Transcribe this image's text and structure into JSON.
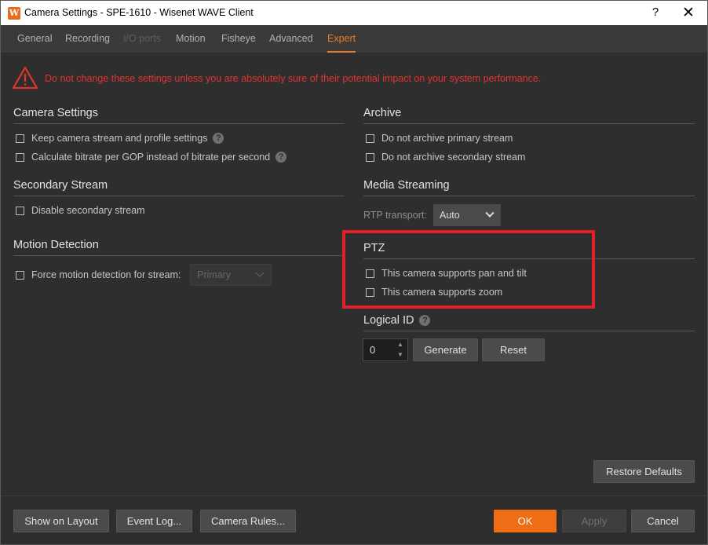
{
  "window": {
    "title": "Camera Settings - SPE-1610 - Wisenet WAVE Client",
    "app_icon": "W",
    "help": "?",
    "close": "✕"
  },
  "tabs": [
    {
      "label": "General",
      "state": "normal"
    },
    {
      "label": "Recording",
      "state": "normal"
    },
    {
      "label": "I/O ports",
      "state": "disabled"
    },
    {
      "label": "Motion",
      "state": "normal"
    },
    {
      "label": "Fisheye",
      "state": "normal"
    },
    {
      "label": "Advanced",
      "state": "normal"
    },
    {
      "label": "Expert",
      "state": "active"
    }
  ],
  "warning": {
    "icon": "warning-triangle-icon",
    "text": "Do not change these settings unless you are absolutely sure of their potential impact on your system performance."
  },
  "camera_settings": {
    "title": "Camera Settings",
    "keep_stream": "Keep camera stream and profile settings",
    "calc_bitrate": "Calculate bitrate per GOP instead of bitrate per second"
  },
  "secondary_stream": {
    "title": "Secondary Stream",
    "disable": "Disable secondary stream"
  },
  "motion_detection": {
    "title": "Motion Detection",
    "force": "Force motion detection for stream:",
    "stream_value": "Primary"
  },
  "archive": {
    "title": "Archive",
    "no_primary": "Do not archive primary stream",
    "no_secondary": "Do not archive secondary stream"
  },
  "media_streaming": {
    "title": "Media Streaming",
    "rtp_label": "RTP transport:",
    "rtp_value": "Auto"
  },
  "ptz": {
    "title": "PTZ",
    "pan_tilt": "This camera supports pan and tilt",
    "zoom": "This camera supports zoom"
  },
  "logical_id": {
    "title": "Logical ID",
    "value": "0",
    "generate": "Generate",
    "reset": "Reset"
  },
  "buttons": {
    "restore_defaults": "Restore Defaults",
    "show_on_layout": "Show on Layout",
    "event_log": "Event Log...",
    "camera_rules": "Camera Rules...",
    "ok": "OK",
    "apply": "Apply",
    "cancel": "Cancel"
  },
  "colors": {
    "accent": "#ef6d15",
    "warning": "#e4332c",
    "highlight": "#e1202a"
  }
}
